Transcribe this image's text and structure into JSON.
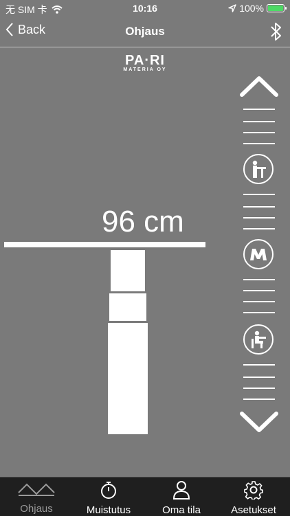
{
  "status": {
    "carrier": "无 SIM 卡",
    "time": "10:16",
    "battery": "100%"
  },
  "nav": {
    "back_label": "Back",
    "title": "Ohjaus"
  },
  "logo": {
    "brand": "PA·RI",
    "sub": "MATERIA OY"
  },
  "desk": {
    "height_text": "96 cm"
  },
  "controls": {
    "icons": [
      "chevron-up-icon",
      "standing-icon",
      "memory-m-icon",
      "sitting-icon",
      "chevron-down-icon"
    ]
  },
  "tabs": [
    {
      "label": "Ohjaus",
      "icon": "table-icon",
      "active": true
    },
    {
      "label": "Muistutus",
      "icon": "stopwatch-icon",
      "active": false
    },
    {
      "label": "Oma tila",
      "icon": "person-icon",
      "active": false
    },
    {
      "label": "Asetukset",
      "icon": "gear-icon",
      "active": false
    }
  ],
  "colors": {
    "background": "#7a7a7a",
    "tabbar": "#1f1f1f",
    "battery": "#4cd964"
  }
}
